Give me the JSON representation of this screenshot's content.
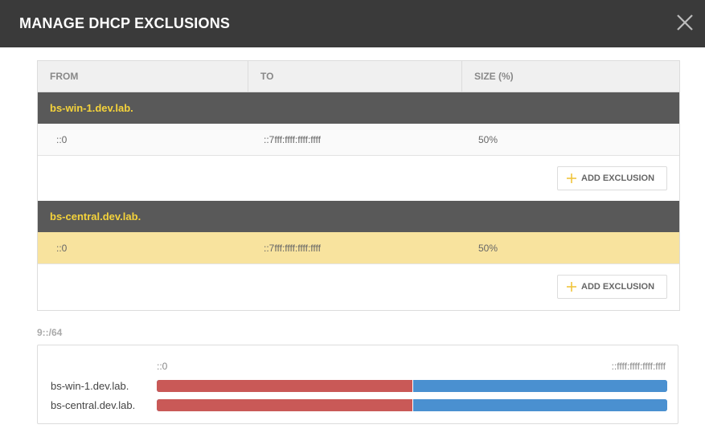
{
  "dialog": {
    "title": "MANAGE DHCP EXCLUSIONS"
  },
  "table": {
    "columns": [
      "FROM",
      "TO",
      "SIZE (%)"
    ],
    "groups": [
      {
        "name": "bs-win-1.dev.lab.",
        "rows": [
          {
            "from": "::0",
            "to": "::7fff:ffff:ffff:ffff",
            "size": "50%"
          }
        ],
        "add_label": "ADD EXCLUSION"
      },
      {
        "name": "bs-central.dev.lab.",
        "rows": [
          {
            "from": "::0",
            "to": "::7fff:ffff:ffff:ffff",
            "size": "50%",
            "selected": true
          }
        ],
        "add_label": "ADD EXCLUSION"
      }
    ]
  },
  "subnet": {
    "label": "9::/64",
    "scale_start": "::0",
    "scale_end": "::ffff:ffff:ffff:ffff",
    "bars": [
      {
        "name": "bs-win-1.dev.lab.",
        "excluded_fraction": 0.5
      },
      {
        "name": "bs-central.dev.lab.",
        "excluded_fraction": 0.5
      }
    ]
  },
  "colors": {
    "header_bg": "#3a3a3a",
    "group_bg": "#595959",
    "group_text": "#f5d33b",
    "selected_row": "#f8e39e",
    "excluded": "#c95957",
    "available": "#4a90d0"
  },
  "icons": {
    "close": "close-icon",
    "add": "plus-icon"
  }
}
